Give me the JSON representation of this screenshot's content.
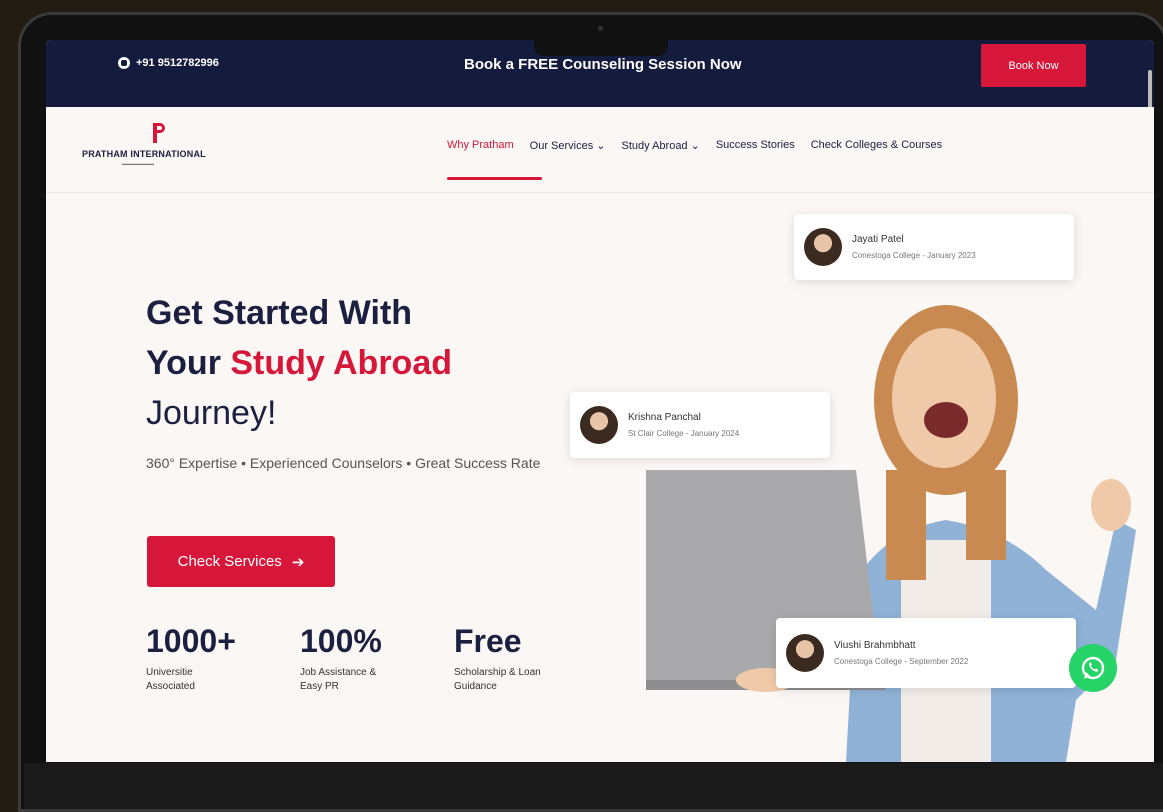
{
  "topbar": {
    "phone": "+91 9512782996",
    "promo": "Book a FREE Counseling Session Now",
    "book_button": "Book Now"
  },
  "nav": {
    "logo_text": "PRATHAM INTERNATIONAL",
    "items": [
      {
        "label": "Why Pratham"
      },
      {
        "label": "Our Services ⌄"
      },
      {
        "label": "Study Abroad ⌄"
      },
      {
        "label": "Success Stories"
      },
      {
        "label": "Check Colleges & Courses"
      }
    ]
  },
  "hero": {
    "title_line1": "Get Started With",
    "title_line2_prefix": "Your ",
    "title_line2_accent": "Study Abroad",
    "title_line3": "Journey!",
    "tagline": "360° Expertise • Experienced Counselors • Great Success Rate",
    "cta_label": "Check Services",
    "cta_arrow": "➔"
  },
  "stats": [
    {
      "value": "1000+",
      "label": "Universitie Associated"
    },
    {
      "value": "100%",
      "label": "Job Assistance & Easy PR"
    },
    {
      "value": "Free",
      "label": "Scholarship & Loan Guidance"
    }
  ],
  "testimonials": [
    {
      "name": "Jayati Patel",
      "detail": "Conestoga College - January 2023"
    },
    {
      "name": "Krishna Panchal",
      "detail": "St Clair College - January 2024"
    },
    {
      "name": "Viushi Brahmbhatt",
      "detail": "Conestoga College - September 2022"
    }
  ],
  "colors": {
    "accent": "#d6173a",
    "navy": "#141b3d",
    "whatsapp": "#25d366"
  }
}
